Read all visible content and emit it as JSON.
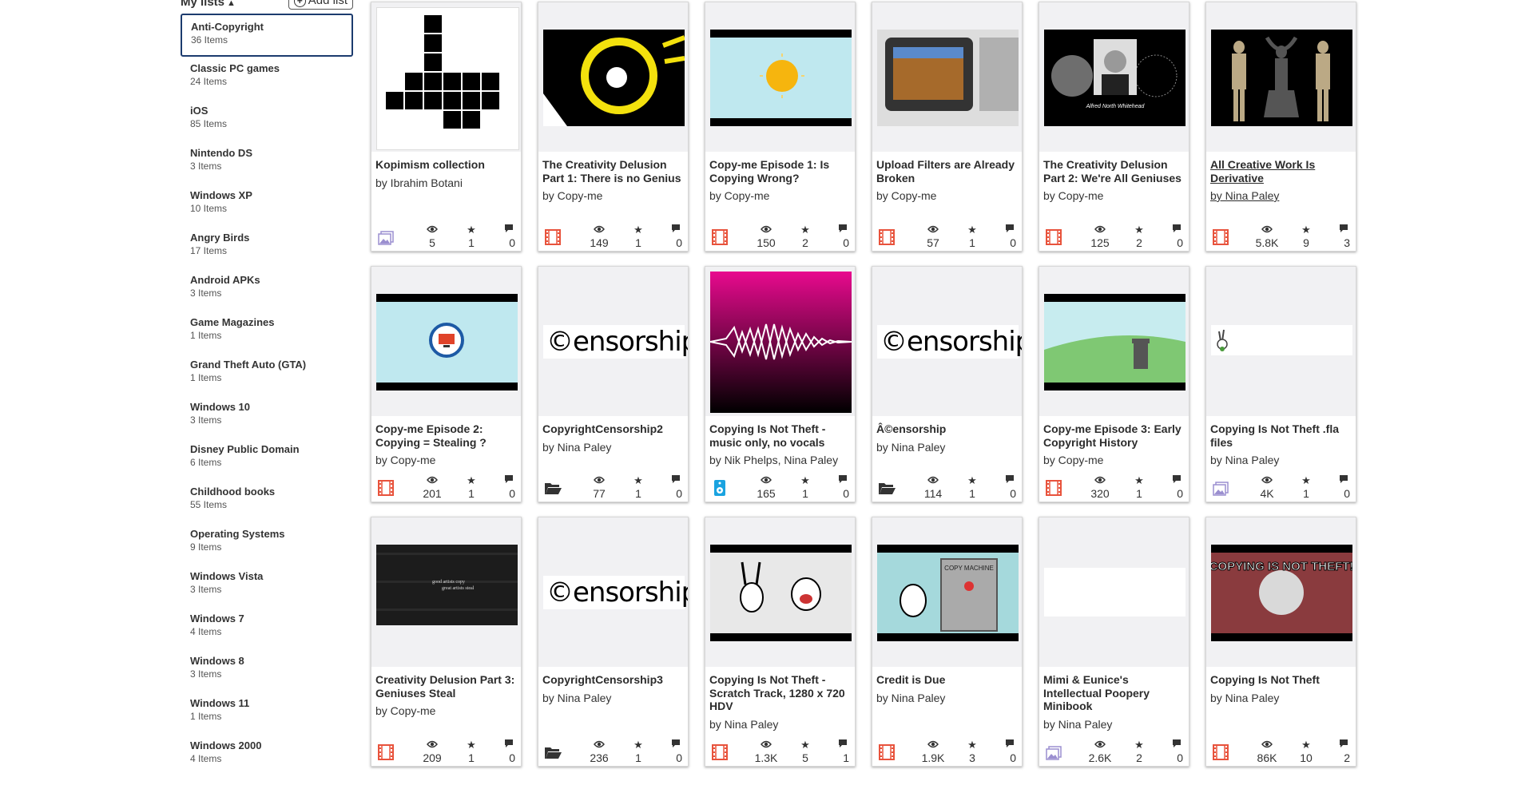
{
  "sidebar": {
    "title": "My lists",
    "add_label": "Add list",
    "lists": [
      {
        "name": "Anti-Copyright",
        "count": "36 Items"
      },
      {
        "name": "Classic PC games",
        "count": "24 Items"
      },
      {
        "name": "iOS",
        "count": "85 Items"
      },
      {
        "name": "Nintendo DS",
        "count": "3 Items"
      },
      {
        "name": "Windows XP",
        "count": "10 Items"
      },
      {
        "name": "Angry Birds",
        "count": "17 Items"
      },
      {
        "name": "Android APKs",
        "count": "3 Items"
      },
      {
        "name": "Game Magazines",
        "count": "1 Items"
      },
      {
        "name": "Grand Theft Auto (GTA)",
        "count": "1 Items"
      },
      {
        "name": "Windows 10",
        "count": "3 Items"
      },
      {
        "name": "Disney Public Domain",
        "count": "6 Items"
      },
      {
        "name": "Childhood books",
        "count": "55 Items"
      },
      {
        "name": "Operating Systems",
        "count": "9 Items"
      },
      {
        "name": "Windows Vista",
        "count": "3 Items"
      },
      {
        "name": "Windows 7",
        "count": "4 Items"
      },
      {
        "name": "Windows 8",
        "count": "3 Items"
      },
      {
        "name": "Windows 11",
        "count": "1 Items"
      },
      {
        "name": "Windows 2000",
        "count": "4 Items"
      }
    ]
  },
  "cards": [
    {
      "title": "Kopimism collection",
      "by": "by Ibrahim Botani",
      "views": "5",
      "favs": "1",
      "reviews": "0",
      "media": "image",
      "thumb": "kopimism"
    },
    {
      "title": "The Creativity Delusion Part 1: There is no Genius",
      "by": "by Copy-me",
      "views": "149",
      "favs": "1",
      "reviews": "0",
      "media": "movie",
      "thumb": "delusion1"
    },
    {
      "title": "Copy-me Episode 1: Is Copying Wrong?",
      "by": "by Copy-me",
      "views": "150",
      "favs": "2",
      "reviews": "0",
      "media": "movie",
      "thumb": "sun"
    },
    {
      "title": "Upload Filters are Already Broken",
      "by": "by Copy-me",
      "views": "57",
      "favs": "1",
      "reviews": "0",
      "media": "movie",
      "thumb": "tv"
    },
    {
      "title": "The Creativity Delusion Part 2: We're All Geniuses",
      "by": "by Copy-me",
      "views": "125",
      "favs": "2",
      "reviews": "0",
      "media": "movie",
      "thumb": "whitehead"
    },
    {
      "title": "All Creative Work Is Derivative",
      "by": "by Nina Paley",
      "views": "5.8K",
      "favs": "9",
      "reviews": "3",
      "media": "movie",
      "thumb": "statues",
      "link": true
    },
    {
      "title": "Copy-me Episode 2: Copying = Stealing ?",
      "by": "by Copy-me",
      "views": "201",
      "favs": "1",
      "reviews": "0",
      "media": "movie",
      "thumb": "monitor"
    },
    {
      "title": "CopyrightCensorship2",
      "by": "by Nina Paley",
      "views": "77",
      "favs": "1",
      "reviews": "0",
      "media": "folder",
      "thumb": "censor"
    },
    {
      "title": "Copying Is Not Theft - music only, no vocals",
      "by": "by Nik Phelps, Nina Paley",
      "views": "165",
      "favs": "1",
      "reviews": "0",
      "media": "audio",
      "thumb": "wave"
    },
    {
      "title": "Â©ensorship",
      "by": "by Nina Paley",
      "views": "114",
      "favs": "1",
      "reviews": "0",
      "media": "folder",
      "thumb": "censor"
    },
    {
      "title": "Copy-me Episode 3: Early Copyright History",
      "by": "by Copy-me",
      "views": "320",
      "favs": "1",
      "reviews": "0",
      "media": "movie",
      "thumb": "hill"
    },
    {
      "title": "Copying Is Not Theft .fla files",
      "by": "by Nina Paley",
      "views": "4K",
      "favs": "1",
      "reviews": "0",
      "media": "image",
      "thumb": "bunny"
    },
    {
      "title": "Creativity Delusion Part 3: Geniuses Steal",
      "by": "by Copy-me",
      "views": "209",
      "favs": "1",
      "reviews": "0",
      "media": "movie",
      "thumb": "books"
    },
    {
      "title": "CopyrightCensorship3",
      "by": "by Nina Paley",
      "views": "236",
      "favs": "1",
      "reviews": "0",
      "media": "folder",
      "thumb": "censor"
    },
    {
      "title": "Copying Is Not Theft - Scratch Track, 1280 x 720 HDV",
      "by": "by Nina Paley",
      "views": "1.3K",
      "favs": "5",
      "reviews": "1",
      "media": "movie",
      "thumb": "cartoon"
    },
    {
      "title": "Credit is Due",
      "by": "by Nina Paley",
      "views": "1.9K",
      "favs": "3",
      "reviews": "0",
      "media": "movie",
      "thumb": "copymachine"
    },
    {
      "title": "Mimi & Eunice's Intellectual Poopery Minibook",
      "by": "by Nina Paley",
      "views": "2.6K",
      "favs": "2",
      "reviews": "0",
      "media": "image",
      "thumb": "minibook"
    },
    {
      "title": "Copying Is Not Theft",
      "by": "by Nina Paley",
      "views": "86K",
      "favs": "10",
      "reviews": "2",
      "media": "movie",
      "thumb": "cint"
    }
  ],
  "thumb_text": {
    "censor": "©ensorship",
    "whitehead": "Alfred North Whitehead",
    "copymachine": "COPY MACHINE",
    "cint": "COPYING IS NOT THEFT!",
    "books_line1": "good artists copy",
    "books_line2": "great artists steal"
  },
  "colors": {
    "movie": "#e8533c",
    "image": "#9b8fd0",
    "audio": "#1aa3e0",
    "folder": "#333333",
    "active_border": "#1c3b6e"
  }
}
